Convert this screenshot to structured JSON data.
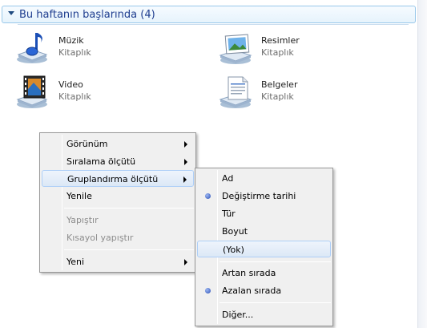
{
  "group": {
    "title": "Bu haftanın başlarında (4)"
  },
  "libraries": [
    {
      "name": "Müzik",
      "type": "Kitaplık",
      "icon": "music-library-icon"
    },
    {
      "name": "Resimler",
      "type": "Kitaplık",
      "icon": "pictures-library-icon"
    },
    {
      "name": "Video",
      "type": "Kitaplık",
      "icon": "video-library-icon"
    },
    {
      "name": "Belgeler",
      "type": "Kitaplık",
      "icon": "documents-library-icon"
    }
  ],
  "context_menu": {
    "items": [
      {
        "label": "Görünüm",
        "submenu": true
      },
      {
        "label": "Sıralama ölçütü",
        "submenu": true
      },
      {
        "label": "Gruplandırma ölçütü",
        "submenu": true,
        "highlighted": true
      },
      {
        "label": "Yenile"
      },
      {
        "label": "Yapıştır",
        "disabled": true
      },
      {
        "label": "Kısayol yapıştır",
        "disabled": true
      },
      {
        "label": "Yeni",
        "submenu": true
      }
    ]
  },
  "submenu": {
    "items": [
      {
        "label": "Ad"
      },
      {
        "label": "Değiştirme tarihi",
        "selected": true
      },
      {
        "label": "Tür"
      },
      {
        "label": "Boyut"
      },
      {
        "label": "(Yok)",
        "highlighted": true
      },
      {
        "label": "Artan sırada"
      },
      {
        "label": "Azalan sırada",
        "selected": true
      },
      {
        "label": "Diğer..."
      }
    ]
  },
  "colors": {
    "group_header_text": "#1e3d8f",
    "menu_background": "#f0f0f0",
    "highlight_border": "#aecff7",
    "radio_dot": "#2b4fb7"
  }
}
